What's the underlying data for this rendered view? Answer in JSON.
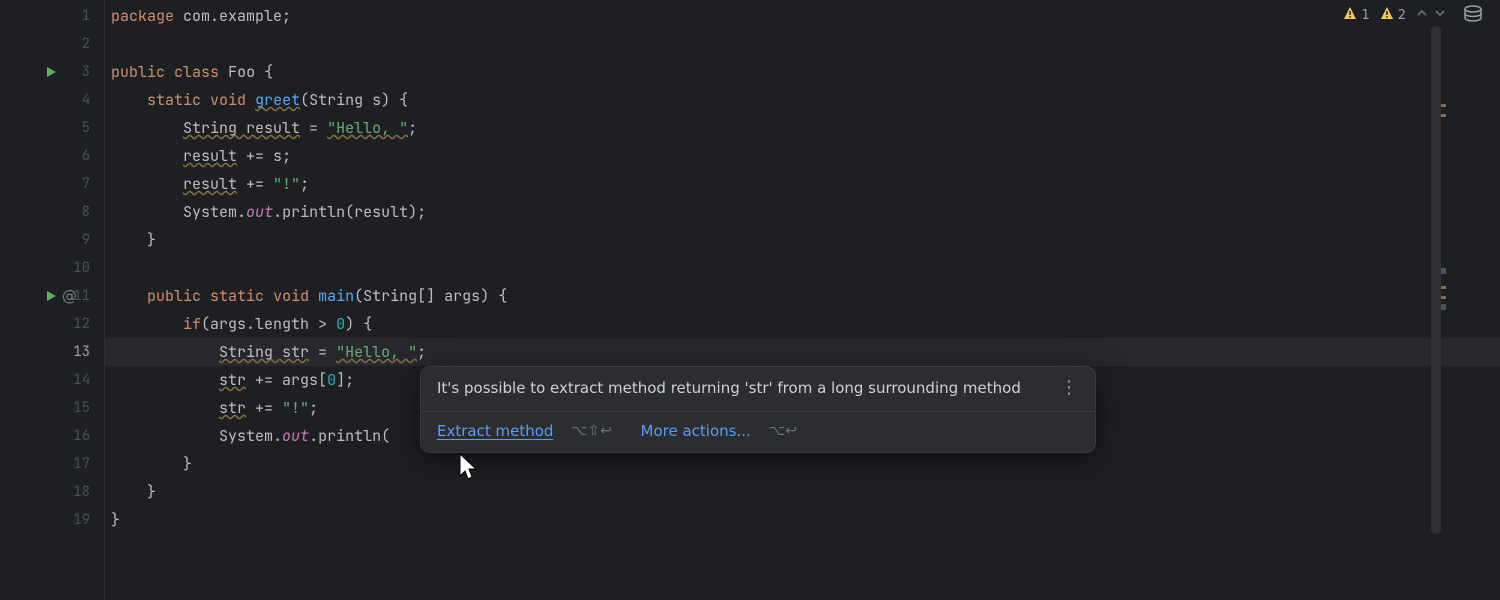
{
  "inspection": {
    "warn1_count": "1",
    "warn2_count": "2"
  },
  "gutter": {
    "run3_name": "run-icon",
    "run11_name": "run-icon",
    "at11_name": "entry-point-icon",
    "bulb_name": "intention-bulb-icon"
  },
  "line_numbers": [
    "1",
    "2",
    "3",
    "4",
    "5",
    "6",
    "7",
    "8",
    "9",
    "10",
    "11",
    "12",
    "13",
    "14",
    "15",
    "16",
    "17",
    "18",
    "19"
  ],
  "code": {
    "l1": {
      "kw_package": "package",
      "pkg": " com.example",
      ";": ";"
    },
    "l3": {
      "kw_public": "public",
      "kw_class": "class",
      "name": "Foo",
      ";": " {"
    },
    "l4": {
      "kw_static": "static",
      "kw_void": "void",
      "name": "greet",
      "params_open": "(",
      "param_type": "String",
      "param_name": " s",
      "params_close": ") {"
    },
    "l5": {
      "type": "String",
      "var": " result",
      "op": " = ",
      "lit": "\"Hello, \"",
      ";": ";"
    },
    "l6": {
      "var": "result",
      "op": " += ",
      "rhs": "s",
      ";": ";"
    },
    "l7": {
      "var": "result",
      "op": " += ",
      "lit": "\"!\"",
      ";": ";"
    },
    "l8": {
      "sys": "System",
      "dot": ".",
      "out": "out",
      "dot2": ".",
      "print": "println",
      "open": "(",
      "arg": "result",
      "close": ");"
    },
    "l9": {
      "close_brace": "}"
    },
    "l11": {
      "kw_public": "public",
      "kw_static": "static",
      "kw_void": "void",
      "name": "main",
      "open": "(",
      "type": "String",
      "arr": "[]",
      "param": " args",
      "close": ") {"
    },
    "l12": {
      "kw_if": "if",
      "open": "(",
      "expr": "args.length",
      "op": " > ",
      "num": "0",
      "close": ") {"
    },
    "l13": {
      "type": "String",
      "var": " str",
      "op": " = ",
      "lit": "\"Hello, \"",
      ";": ";"
    },
    "l14": {
      "var": "str",
      "op": " += ",
      "arr": "args",
      "open": "[",
      "idx": "0",
      "close": "]",
      ";": ";"
    },
    "l15": {
      "var": "str",
      "op": " += ",
      "lit": "\"!\"",
      ";": ";"
    },
    "l16": {
      "sys": "System",
      "dot": ".",
      "out": "out",
      "dot2": ".",
      "print": "println",
      "open": "("
    },
    "l17": {
      "close_brace": "}"
    },
    "l18": {
      "close_brace": "}"
    },
    "l19": {
      "close_brace": "}"
    }
  },
  "intention": {
    "message": "It's possible to extract method returning 'str' from a long surrounding method",
    "primary_label": "Extract method",
    "primary_shortcut": "⌥⇧↩",
    "secondary_label": "More actions...",
    "secondary_shortcut": "⌥↩"
  },
  "db_icon_name": "database-icon"
}
